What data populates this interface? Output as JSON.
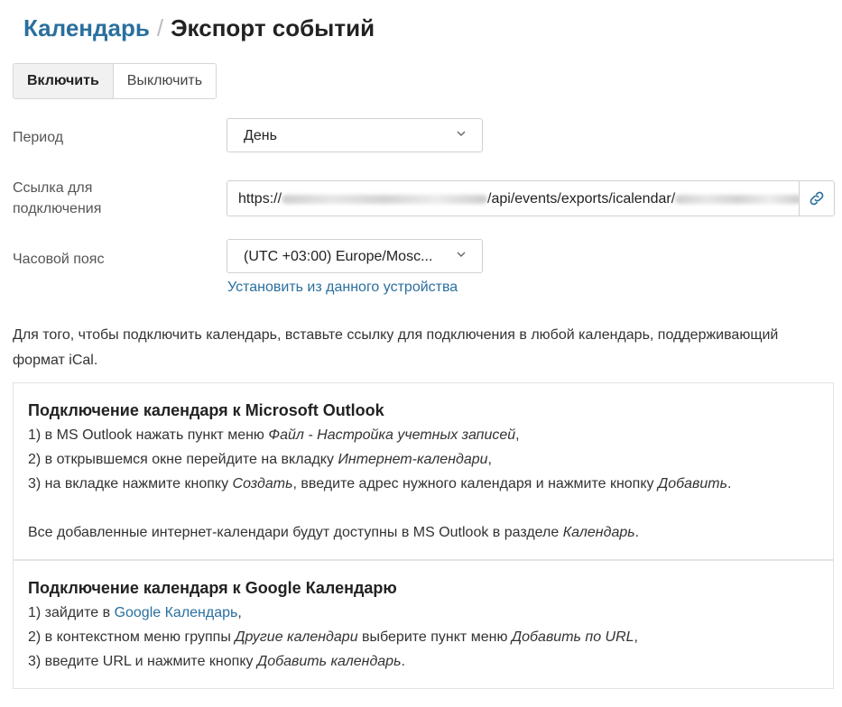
{
  "breadcrumb": {
    "parent": "Календарь",
    "separator": "/",
    "current": "Экспорт событий"
  },
  "toggle": {
    "on_label": "Включить",
    "off_label": "Выключить",
    "active": "on"
  },
  "form": {
    "period_label": "Период",
    "period_value": "День",
    "link_label_line1": "Ссылка для",
    "link_label_line2": "подключения",
    "link_prefix": "https://",
    "link_middle": "/api/events/exports/icalendar/",
    "timezone_label": "Часовой пояс",
    "timezone_value": "(UTC +03:00) Europe/Mosc...",
    "device_link": "Установить из данного устройства"
  },
  "intro_text": "Для того, чтобы подключить календарь, вставьте ссылку для подключения в любой календарь, поддерживающий формат iCal.",
  "outlook": {
    "title": "Подключение календаря к Microsoft Outlook",
    "step1_text": "1) в MS Outlook нажать пункт меню ",
    "step1_em": "Файл - Настройка учетных записей",
    "step1_end": ",",
    "step2_text": "2) в открывшемся окне перейдите на вкладку ",
    "step2_em": "Интернет-календари",
    "step2_end": ",",
    "step3_text": "3) на вкладке нажмите кнопку ",
    "step3_em1": "Создать",
    "step3_mid": ", введите адрес нужного календаря и нажмите кнопку ",
    "step3_em2": "Добавить",
    "step3_end": ".",
    "note_text": "Все добавленные интернет-календари будут доступны в MS Outlook в разделе ",
    "note_em": "Календарь",
    "note_end": "."
  },
  "google": {
    "title": "Подключение календаря к Google Календарю",
    "step1_text": "1) зайдите в ",
    "step1_link": "Google Календарь",
    "step1_end": ",",
    "step2_text": "2) в контекстном меню группы ",
    "step2_em1": "Другие календари",
    "step2_mid": " выберите пункт меню ",
    "step2_em2": "Добавить по URL",
    "step2_end": ",",
    "step3_text": "3) введите URL и нажмите кнопку ",
    "step3_em": "Добавить календарь",
    "step3_end": "."
  },
  "icons": {
    "chevron": "chevron-down-icon",
    "copy": "link-icon"
  },
  "colors": {
    "link": "#2a6f9e",
    "text": "#333333",
    "border": "#d0d0d0",
    "toggle_active_bg": "#f1f1f1"
  }
}
